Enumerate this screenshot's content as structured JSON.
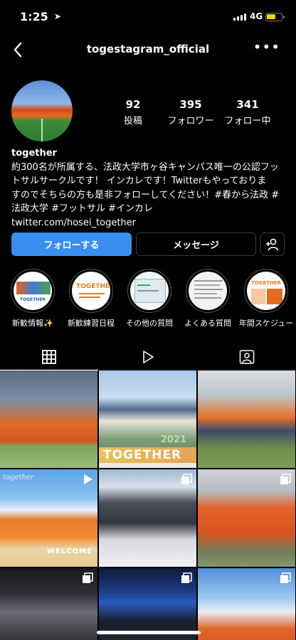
{
  "status": {
    "time": "1:25",
    "network": "4G"
  },
  "header": {
    "username": "togestagram_official"
  },
  "stats": [
    {
      "value": "92",
      "label": "投稿"
    },
    {
      "value": "395",
      "label": "フォロワー"
    },
    {
      "value": "341",
      "label": "フォロー中"
    }
  ],
  "bio": {
    "name": "together",
    "line1": "約300名が所属する、法政大学市ヶ谷キャンパス唯一の公認フッ",
    "line2": "トサルサークルです！ インカレです！Twitterもやっておりま",
    "line3": "すのでそちらの方も是非フォローしてください！#春から法政 #",
    "line4": "法政大学 #フットサル #インカレ",
    "link": "twitter.com/hosei_together"
  },
  "buttons": {
    "follow": "フォローする",
    "message": "メッセージ"
  },
  "highlights": [
    {
      "label": "新歓情報✨",
      "image_text": "TOGETHER"
    },
    {
      "label": "新歓練習日程",
      "image_text": "TOGETHER"
    },
    {
      "label": "その他の質問",
      "image_text": ""
    },
    {
      "label": "よくある質問",
      "image_text": ""
    },
    {
      "label": "年間スケジュー",
      "image_text": "TOGETHER"
    }
  ],
  "posts": [
    {
      "overlay_text": ""
    },
    {
      "overlay_text": "TOGETHER",
      "year": "2021"
    },
    {
      "overlay_text": ""
    },
    {
      "overlay_text": "together",
      "banner": "WELCOME"
    },
    {
      "overlay_text": ""
    },
    {
      "overlay_text": ""
    },
    {
      "overlay_text": ""
    },
    {
      "overlay_text": ""
    },
    {
      "overlay_text": ""
    }
  ],
  "colors": {
    "accent": "#3a8ef0",
    "battery": "#f5d000"
  }
}
